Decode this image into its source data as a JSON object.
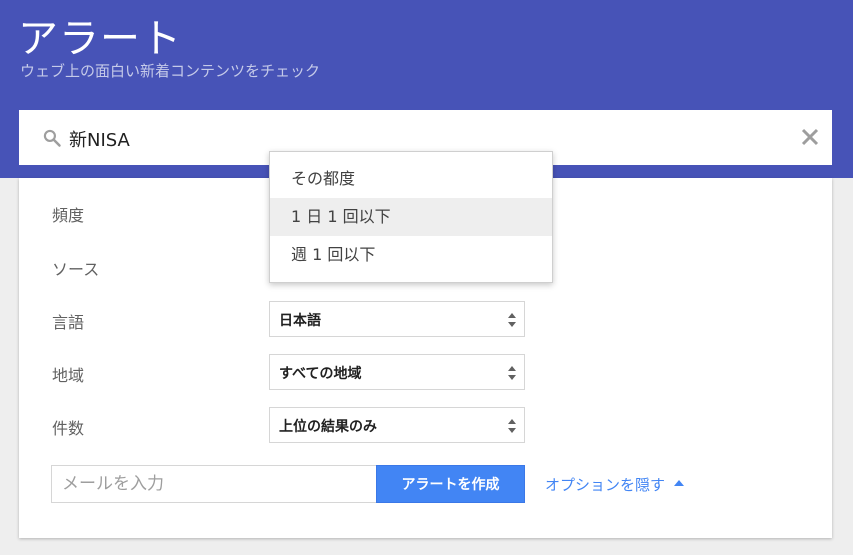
{
  "header": {
    "title": "アラート",
    "subtitle": "ウェブ上の面白い新着コンテンツをチェック"
  },
  "search": {
    "value": "新NISA",
    "icon": "search-icon",
    "clear_icon": "close-icon"
  },
  "settings": {
    "frequency_label": "頻度",
    "source_label": "ソース",
    "language": {
      "label": "言語",
      "value": "日本語"
    },
    "region": {
      "label": "地域",
      "value": "すべての地域"
    },
    "count": {
      "label": "件数",
      "value": "上位の結果のみ"
    }
  },
  "frequency_dropdown": {
    "options": [
      "その都度",
      "1 日 1 回以下",
      "週 1 回以下"
    ],
    "highlighted": "1 日 1 回以下"
  },
  "email": {
    "placeholder": "メールを入力"
  },
  "create_button_label": "アラートを作成",
  "options_link_label": "オプションを隠す",
  "colors": {
    "header_bg": "#4753b7",
    "accent": "#4285f4"
  }
}
